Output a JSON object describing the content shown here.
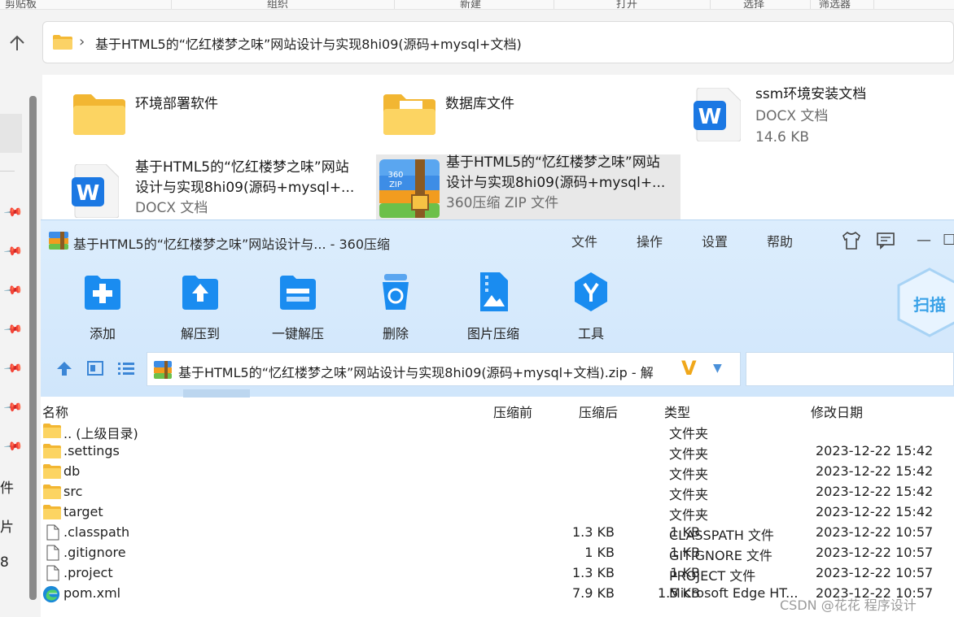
{
  "explorer": {
    "ribbon": [
      "剪贴板",
      "组织",
      "新建",
      "打开",
      "选择",
      "筛选器"
    ],
    "address": "基于HTML5的“忆红楼梦之味”网站设计与实现8hi09(源码+mysql+文档)",
    "sidebar_chars": [
      "件",
      "片",
      "8"
    ],
    "items": [
      {
        "name": "环境部署软件",
        "icon": "folder-icon"
      },
      {
        "name": "数据库文件",
        "icon": "folder-icon"
      },
      {
        "name": "ssm环境安装文档",
        "type": "DOCX 文档",
        "size": "14.6 KB",
        "icon": "word-doc-icon"
      },
      {
        "name_line1": "基于HTML5的“忆红楼梦之味”网站",
        "name_line2": "设计与实现8hi09(源码+mysql+...",
        "type": "DOCX 文档",
        "icon": "word-doc-icon"
      },
      {
        "name_line1": "基于HTML5的“忆红楼梦之味”网站",
        "name_line2": "设计与实现8hi09(源码+mysql+...",
        "type": "360压缩 ZIP 文件",
        "icon": "zip-archive-icon"
      }
    ]
  },
  "zip_window": {
    "title": "基于HTML5的“忆红楼梦之味”网站设计与... - 360压缩",
    "menu": [
      "文件",
      "操作",
      "设置",
      "帮助"
    ],
    "toolbar": [
      {
        "label": "添加",
        "icon": "add-icon"
      },
      {
        "label": "解压到",
        "icon": "extract-to-icon"
      },
      {
        "label": "一键解压",
        "icon": "one-click-extract-icon"
      },
      {
        "label": "删除",
        "icon": "delete-icon"
      },
      {
        "label": "图片压缩",
        "icon": "image-compress-icon"
      },
      {
        "label": "工具",
        "icon": "tools-icon"
      }
    ],
    "scan_label": "扫描",
    "path": "基于HTML5的“忆红楼梦之味”网站设计与实现8hi09(源码+mysql+文档).zip - 解",
    "columns": {
      "name": "名称",
      "before": "压缩前",
      "after": "压缩后",
      "type": "类型",
      "date": "修改日期"
    },
    "rows": [
      {
        "name": ".. (上级目录)",
        "before": "",
        "after": "",
        "type": "文件夹",
        "date": "",
        "icon": "folder-icon"
      },
      {
        "name": ".settings",
        "before": "",
        "after": "",
        "type": "文件夹",
        "date": "2023-12-22 15:42",
        "icon": "folder-icon"
      },
      {
        "name": "db",
        "before": "",
        "after": "",
        "type": "文件夹",
        "date": "2023-12-22 15:42",
        "icon": "folder-icon"
      },
      {
        "name": "src",
        "before": "",
        "after": "",
        "type": "文件夹",
        "date": "2023-12-22 15:42",
        "icon": "folder-icon"
      },
      {
        "name": "target",
        "before": "",
        "after": "",
        "type": "文件夹",
        "date": "2023-12-22 15:42",
        "icon": "folder-icon"
      },
      {
        "name": ".classpath",
        "before": "1.3 KB",
        "after": "1 KB",
        "type": "CLASSPATH 文件",
        "date": "2023-12-22 10:57",
        "icon": "file-icon"
      },
      {
        "name": ".gitignore",
        "before": "1 KB",
        "after": "1 KB",
        "type": "GITIGNORE 文件",
        "date": "2023-12-22 10:57",
        "icon": "file-icon"
      },
      {
        "name": ".project",
        "before": "1.3 KB",
        "after": "1 KB",
        "type": "PROJECT 文件",
        "date": "2023-12-22 10:57",
        "icon": "file-icon"
      },
      {
        "name": "pom.xml",
        "before": "7.9 KB",
        "after": "1.5 KB",
        "type": "Microsoft Edge HT...",
        "date": "2023-12-22 10:57",
        "icon": "edge-icon"
      }
    ]
  },
  "watermark": "CSDN @花花 程序设计",
  "colors": {
    "accent": "#1a8cf0",
    "toolbar_bg": "#d6e9fc",
    "folder": "#f7c948"
  }
}
